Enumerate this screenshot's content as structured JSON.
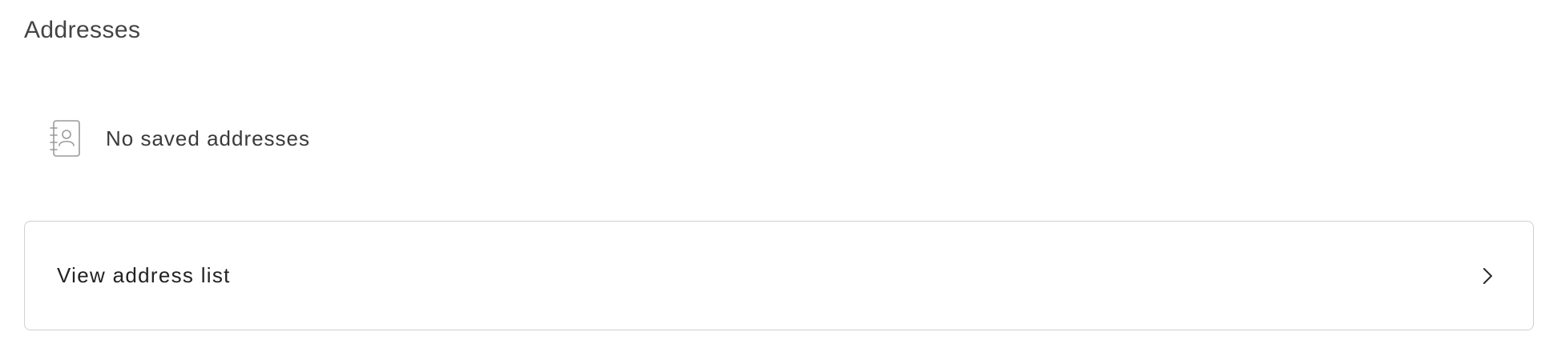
{
  "section": {
    "title": "Addresses"
  },
  "empty_state": {
    "icon": "address-book-icon",
    "text": "No saved addresses"
  },
  "address_list_link": {
    "label": "View address list",
    "icon": "chevron-right-icon"
  }
}
